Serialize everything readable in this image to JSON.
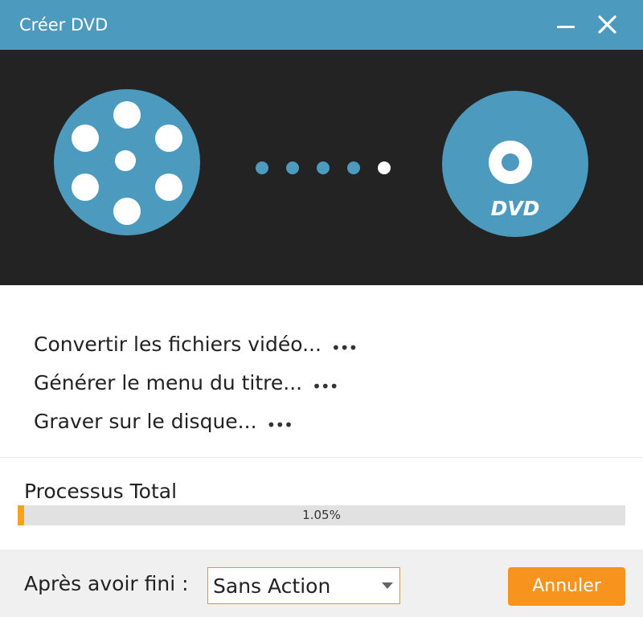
{
  "window": {
    "title": "Créer DVD",
    "minimize_icon": "minimize-icon",
    "close_icon": "close-icon"
  },
  "banner": {
    "source_icon": "film-reel-icon",
    "target_icon": "dvd-disc-icon",
    "dvd_label": "DVD",
    "dots_total": 5,
    "dots_active_index": 4,
    "colors": {
      "background": "#232323",
      "accent": "#4c9bbf",
      "active_dot": "#ffffff"
    }
  },
  "steps": [
    {
      "label": "Convertir les fichiers vidéo...",
      "status": "•••"
    },
    {
      "label": "Générer le menu du titre...",
      "status": "•••"
    },
    {
      "label": "Graver sur le disque...",
      "status": "•••"
    }
  ],
  "progress": {
    "title": "Processus Total",
    "value": 1.05,
    "text": "1.05%",
    "color": "#f7a21a"
  },
  "footer": {
    "after_label": "Après avoir fini :",
    "after_action": "Sans Action",
    "cancel_label": "Annuler",
    "cancel_color": "#f7941d"
  }
}
